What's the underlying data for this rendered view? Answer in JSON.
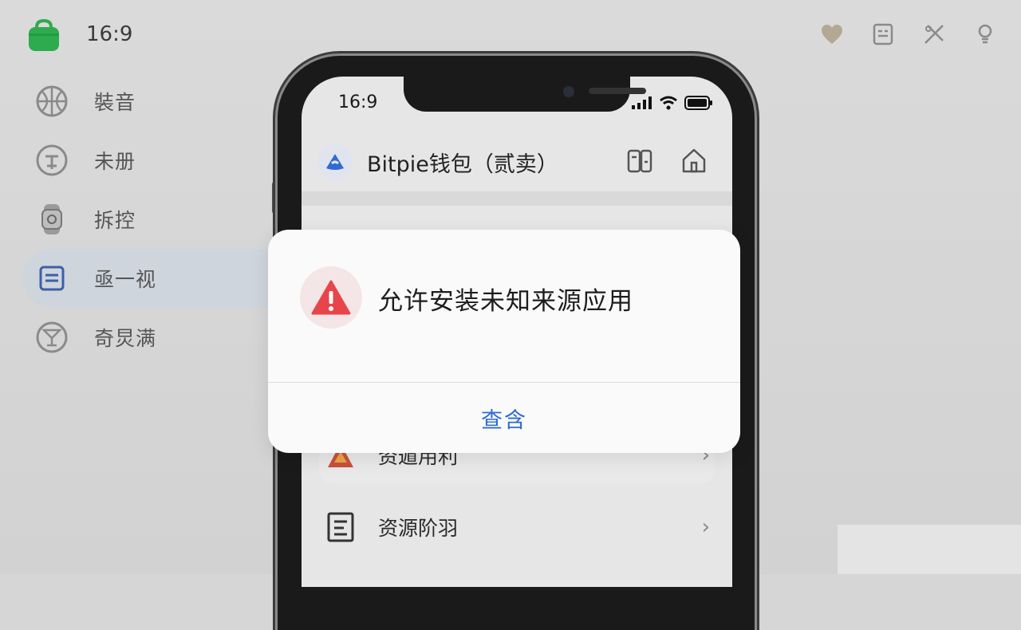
{
  "desktop": {
    "time": "16:9",
    "sidebar": [
      {
        "label": "裝音",
        "icon": "basketball-icon"
      },
      {
        "label": "未册",
        "icon": "clock-icon"
      },
      {
        "label": "拆控",
        "icon": "watch-icon"
      },
      {
        "label": "亟一视",
        "icon": "list-icon",
        "active": true
      },
      {
        "label": "奇炅满",
        "icon": "cocktail-icon"
      }
    ],
    "top_icons": [
      "heart-icon",
      "document-icon",
      "tools-icon",
      "bulb-icon"
    ]
  },
  "phone": {
    "status_time": "16:9",
    "app_title": "Bitpie钱包（贰卖）",
    "rows": [
      {
        "label": "资遁用利",
        "icon": "warning-icon"
      },
      {
        "label": "资源阶羽",
        "icon": "document-icon"
      }
    ]
  },
  "dialog": {
    "title": "允许安装未知来源应用",
    "button": "查含",
    "accent_color": "#2f6bd1",
    "warning_color": "#e8454a"
  }
}
